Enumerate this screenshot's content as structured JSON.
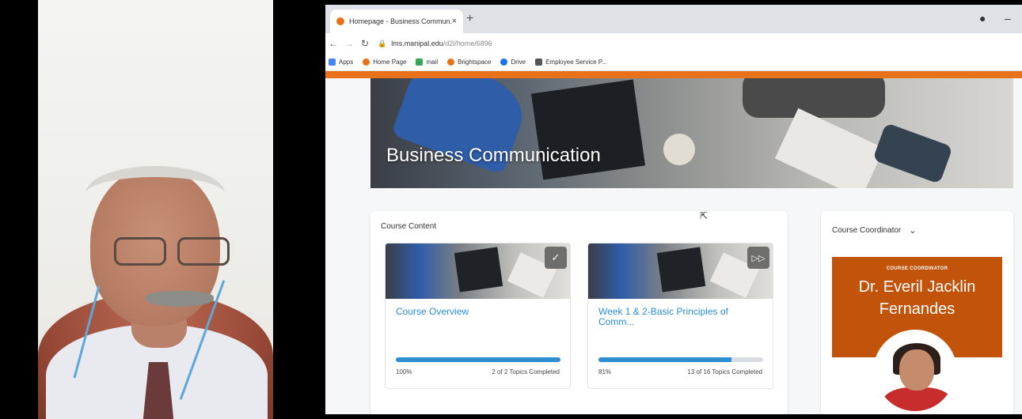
{
  "browser": {
    "tab_title": "Homepage - Business Commun...",
    "tab_close": "×",
    "new_tab": "+",
    "url_host": "lms.manipal.edu",
    "url_path": "/d2l/home/6896",
    "bookmarks": [
      {
        "label": "Apps",
        "color": "#4285f4"
      },
      {
        "label": "Home Page",
        "color": "#e8711a"
      },
      {
        "label": "mail",
        "color": "#34a853"
      },
      {
        "label": "Brightspace",
        "color": "#e8711a"
      },
      {
        "label": "Drive",
        "color": "#1a73e8"
      },
      {
        "label": "Employee Service P...",
        "color": "#555555"
      }
    ]
  },
  "banner": {
    "title": "Business Communication"
  },
  "course_content": {
    "title": "Course Content",
    "modules": [
      {
        "title": "Course Overview",
        "percent": "100%",
        "progress": 1.0,
        "count": "2 of 2 Topics Completed",
        "badge": "✓"
      },
      {
        "title": "Week 1 & 2-Basic Principles of Comm...",
        "percent": "81%",
        "progress": 0.81,
        "count": "13 of 16 Topics Completed",
        "badge": "▷▷"
      }
    ]
  },
  "coordinator": {
    "title": "Course Coordinator",
    "label": "COURSE COORDINATOR",
    "name_line1": "Dr. Everil Jacklin",
    "name_line2": "Fernandes"
  },
  "colors": {
    "accent": "#e8711a",
    "link": "#2b8fd1",
    "coordinator_bg": "#c2530a"
  }
}
